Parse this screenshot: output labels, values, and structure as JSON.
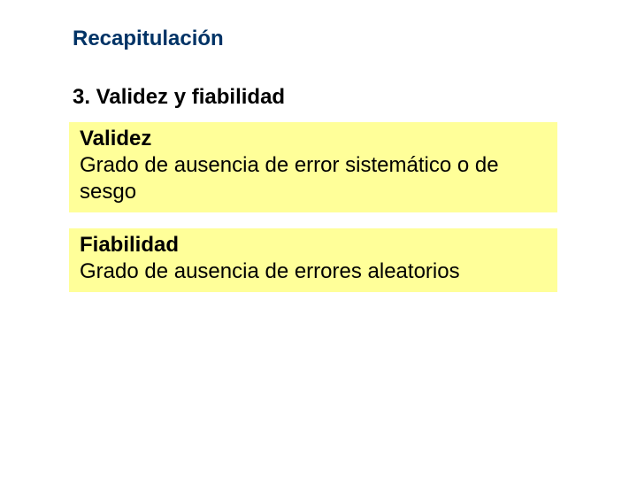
{
  "title": "Recapitulación",
  "section": "3.  Validez y fiabilidad",
  "definitions": [
    {
      "term": "Validez",
      "text": "Grado de ausencia de error sistemático o de sesgo"
    },
    {
      "term": "Fiabilidad",
      "text": "Grado de ausencia de errores aleatorios"
    }
  ]
}
